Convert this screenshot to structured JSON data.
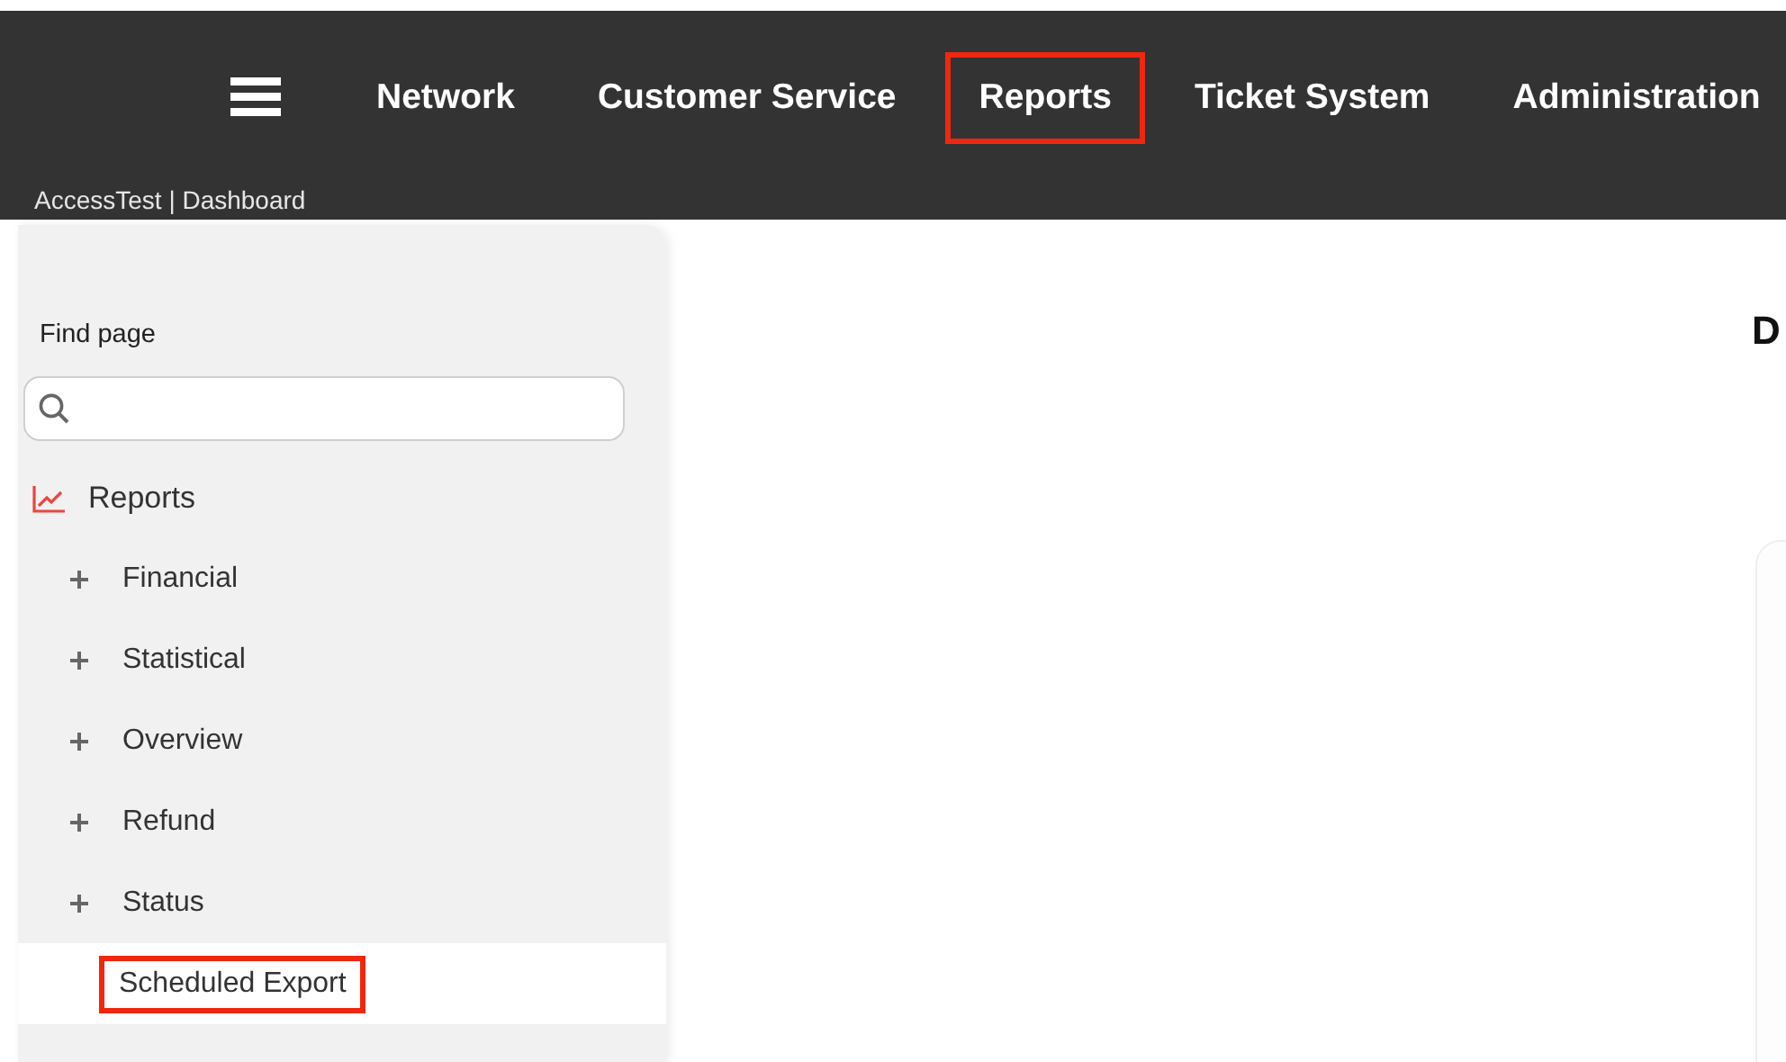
{
  "nav": {
    "items": [
      {
        "label": "Network",
        "highlighted": false
      },
      {
        "label": "Customer Service",
        "highlighted": false
      },
      {
        "label": "Reports",
        "highlighted": true
      },
      {
        "label": "Ticket System",
        "highlighted": false
      },
      {
        "label": "Administration",
        "highlighted": false
      }
    ]
  },
  "breadcrumb": "AccessTest | Dashboard",
  "sidebar": {
    "search_label": "Find page",
    "tree": [
      {
        "label": "Reports",
        "kind": "section",
        "children": [
          {
            "label": "Financial",
            "kind": "group",
            "expanded": false,
            "selected": false,
            "highlighted": false
          },
          {
            "label": "Statistical",
            "kind": "group",
            "expanded": false,
            "selected": false,
            "highlighted": false
          },
          {
            "label": "Overview",
            "kind": "group",
            "expanded": false,
            "selected": false,
            "highlighted": false
          },
          {
            "label": "Refund",
            "kind": "group",
            "expanded": false,
            "selected": false,
            "highlighted": false
          },
          {
            "label": "Status",
            "kind": "group",
            "expanded": false,
            "selected": false,
            "highlighted": false
          },
          {
            "label": "Scheduled Export",
            "kind": "leaf",
            "selected": true,
            "highlighted": true
          }
        ]
      }
    ]
  },
  "main": {
    "heading": "D"
  }
}
